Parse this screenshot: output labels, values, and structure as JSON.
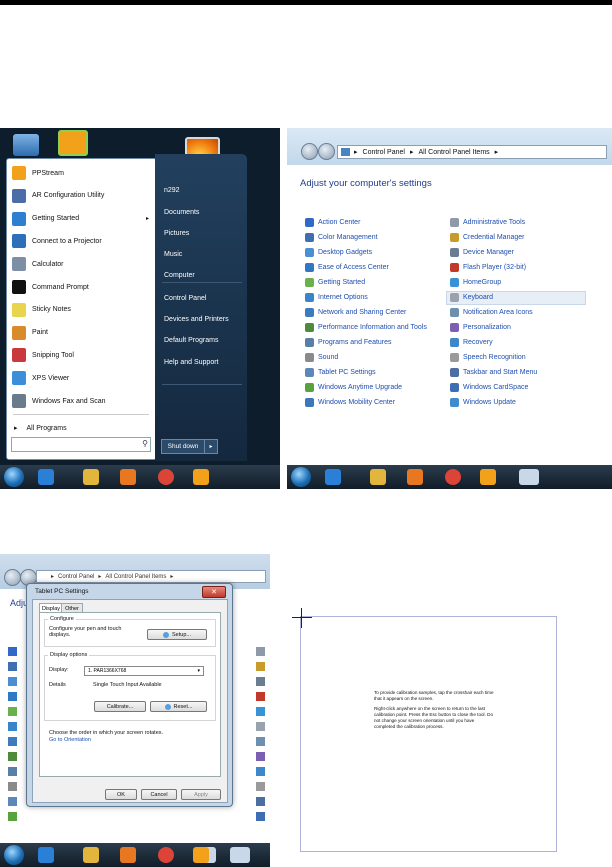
{
  "start_menu": {
    "left_items": [
      {
        "label": "PPStream",
        "color": "#f2a11a",
        "arrow": false
      },
      {
        "label": "AR Configuration Utility",
        "color": "#4b6ea8",
        "arrow": false
      },
      {
        "label": "Getting Started",
        "color": "#2d7fd0",
        "arrow": true
      },
      {
        "label": "Connect to a Projector",
        "color": "#2d6fb8",
        "arrow": false
      },
      {
        "label": "Calculator",
        "color": "#7c8fa4",
        "arrow": false
      },
      {
        "label": "Command Prompt",
        "color": "#111111",
        "arrow": false
      },
      {
        "label": "Sticky Notes",
        "color": "#e8d44d",
        "arrow": false
      },
      {
        "label": "Paint",
        "color": "#d98a2b",
        "arrow": false
      },
      {
        "label": "Snipping Tool",
        "color": "#c8383c",
        "arrow": false
      },
      {
        "label": "XPS Viewer",
        "color": "#3b8fd9",
        "arrow": false
      },
      {
        "label": "Windows Fax and Scan",
        "color": "#6a7b8c",
        "arrow": false
      }
    ],
    "all_programs": "All Programs",
    "right_items": [
      "n292",
      "Documents",
      "Pictures",
      "Music",
      "Computer",
      "Control Panel",
      "Devices and Printers",
      "Default Programs",
      "Help and Support"
    ],
    "shutdown": "Shut down",
    "shutdown_arrow": "▸",
    "all_programs_arrow": "▸",
    "search_icon": "⚲"
  },
  "control_panel": {
    "breadcrumb": [
      "Control Panel",
      "All Control Panel Items"
    ],
    "breadcrumb_sep": "▸",
    "title": "Adjust your computer's settings",
    "left_items": [
      {
        "label": "Action Center",
        "color": "#3169c6"
      },
      {
        "label": "Color Management",
        "color": "#3f6fb0"
      },
      {
        "label": "Desktop Gadgets",
        "color": "#4a8fd1"
      },
      {
        "label": "Ease of Access Center",
        "color": "#2f78c4"
      },
      {
        "label": "Getting Started",
        "color": "#6ab04c"
      },
      {
        "label": "Internet Options",
        "color": "#3a84c9"
      },
      {
        "label": "Network and Sharing Center",
        "color": "#3d7bbf"
      },
      {
        "label": "Performance Information and Tools",
        "color": "#4f8a3a"
      },
      {
        "label": "Programs and Features",
        "color": "#5a7fa6"
      },
      {
        "label": "Sound",
        "color": "#8a8a8a"
      },
      {
        "label": "Tablet PC Settings",
        "color": "#5d87b8"
      },
      {
        "label": "Windows Anytime Upgrade",
        "color": "#58a33e"
      },
      {
        "label": "Windows Mobility Center",
        "color": "#3a78b8"
      }
    ],
    "right_items": [
      {
        "label": "Administrative Tools",
        "color": "#8f9aa8"
      },
      {
        "label": "Credential Manager",
        "color": "#c89b2f"
      },
      {
        "label": "Device Manager",
        "color": "#6b7d90"
      },
      {
        "label": "Flash Player (32-bit)",
        "color": "#c0392b"
      },
      {
        "label": "HomeGroup",
        "color": "#3a92d6"
      },
      {
        "label": "Keyboard",
        "color": "#9aa3ad"
      },
      {
        "label": "Notification Area Icons",
        "color": "#6d8fb0"
      },
      {
        "label": "Personalization",
        "color": "#7c5fb0"
      },
      {
        "label": "Recovery",
        "color": "#3d88c8"
      },
      {
        "label": "Speech Recognition",
        "color": "#9a9a9a"
      },
      {
        "label": "Taskbar and Start Menu",
        "color": "#4a6fa0"
      },
      {
        "label": "Windows CardSpace",
        "color": "#3d6eb4"
      },
      {
        "label": "Windows Update",
        "color": "#3f8bd0"
      }
    ]
  },
  "tablet_dialog": {
    "breadcrumb": [
      "Control Panel",
      "All Control Panel Items"
    ],
    "breadcrumb_sep": "▸",
    "bg_title_fragment": "Adju",
    "title": "Tablet PC Settings",
    "close": "✕",
    "tabs": [
      "Display",
      "Other"
    ],
    "configure_label": "Configure",
    "configure_text": "Configure your pen and touch displays.",
    "setup_button": "Setup...",
    "display_options_label": "Display options",
    "display_label": "Display:",
    "display_value": "1. PAR1366X768",
    "display_dropdown_arrow": "▾",
    "details_label": "Details",
    "details_value": "Single Touch Input Available",
    "calibrate_button": "Calibrate...",
    "reset_button": "Reset...",
    "orientation_text": "Choose the order in which your screen rotates.",
    "orientation_link": "Go to Orientation",
    "ok": "OK",
    "cancel": "Cancel",
    "apply": "Apply"
  },
  "calibration": {
    "para1": "To provide calibration samples, tap the crosshair each time that it appears on the screen.",
    "para2": "Right-click anywhere on the screen to return to the last calibration point. Press the Esc button to close the tool. Do not change your screen orientation until you have completed the calibration process."
  },
  "taskbar": {
    "icons": [
      {
        "name": "start-orb",
        "color": "#1c6fb6"
      },
      {
        "name": "ie-icon",
        "color": "#2a7fd6"
      },
      {
        "name": "explorer-icon",
        "color": "#e2b53c"
      },
      {
        "name": "media-player-icon",
        "color": "#e87722"
      },
      {
        "name": "chrome-icon",
        "color": "#db4437"
      },
      {
        "name": "ppstream-icon",
        "color": "#f2a11a"
      }
    ]
  }
}
